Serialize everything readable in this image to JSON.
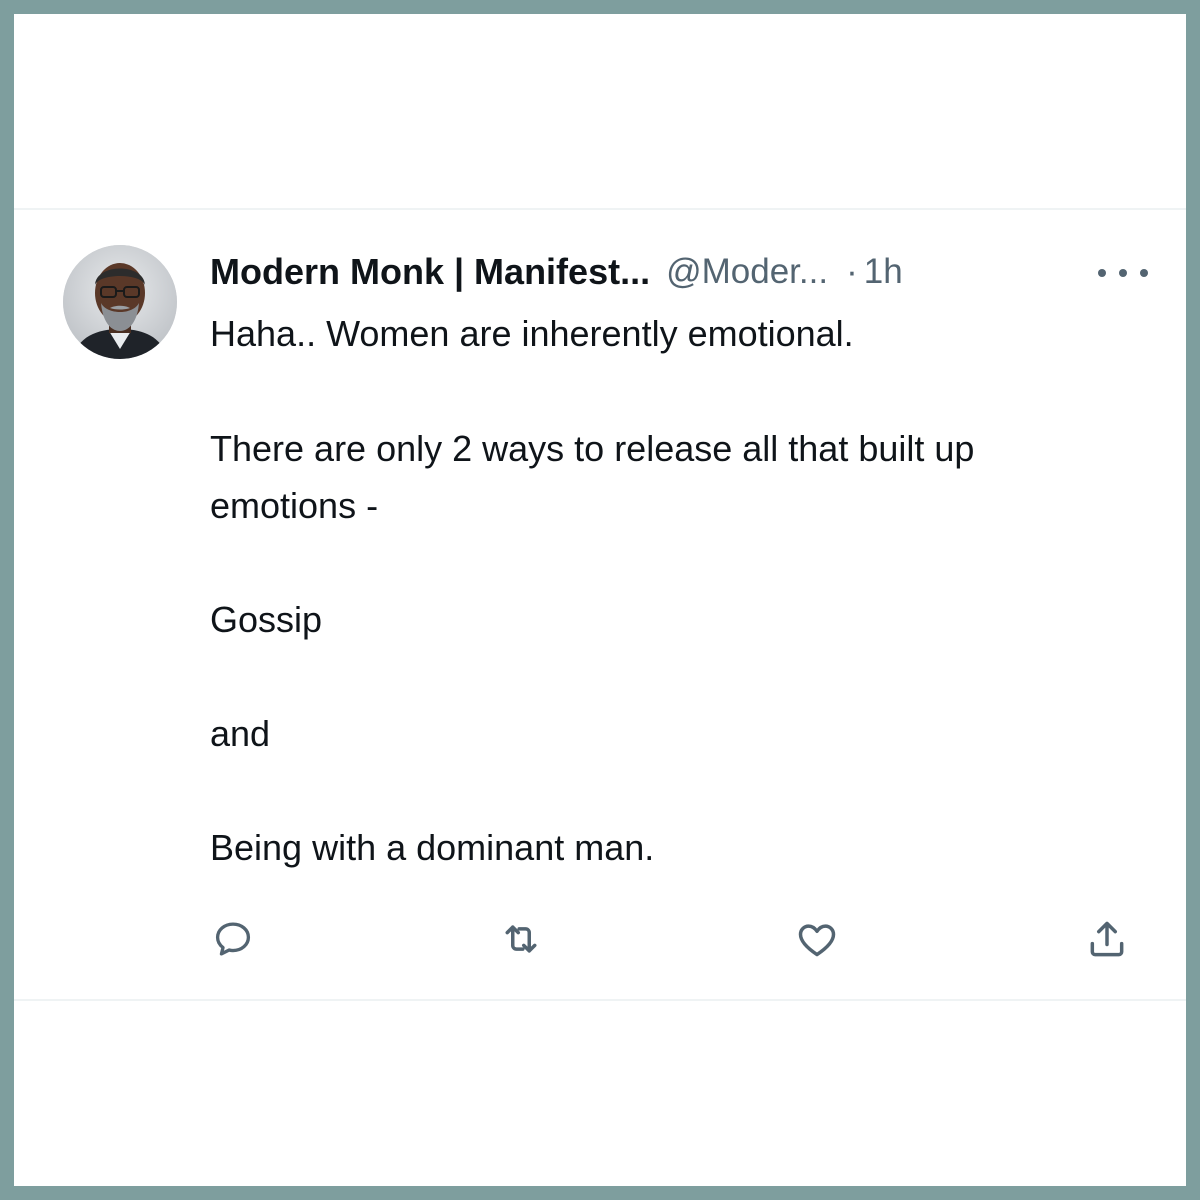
{
  "tweet": {
    "author": {
      "display_name": "Modern Monk | Manifest...",
      "handle": "@Moder...",
      "separator": "·",
      "time": "1h",
      "avatar_icon": "profile-photo"
    },
    "more_icon": "more-dots-icon",
    "lines": [
      "Haha.. Women are inherently emotional.",
      "There are only 2 ways to release all that built up",
      "emotions -",
      "Gossip",
      "and",
      "Being with a dominant man."
    ],
    "actions": [
      {
        "name": "reply",
        "icon": "reply-icon"
      },
      {
        "name": "retweet",
        "icon": "retweet-icon"
      },
      {
        "name": "like",
        "icon": "heart-icon"
      },
      {
        "name": "share",
        "icon": "share-icon"
      }
    ]
  },
  "colors": {
    "frame": "#7e9e9e",
    "text_primary": "#0f1419",
    "text_secondary": "#536471",
    "divider": "#eff3f4"
  }
}
